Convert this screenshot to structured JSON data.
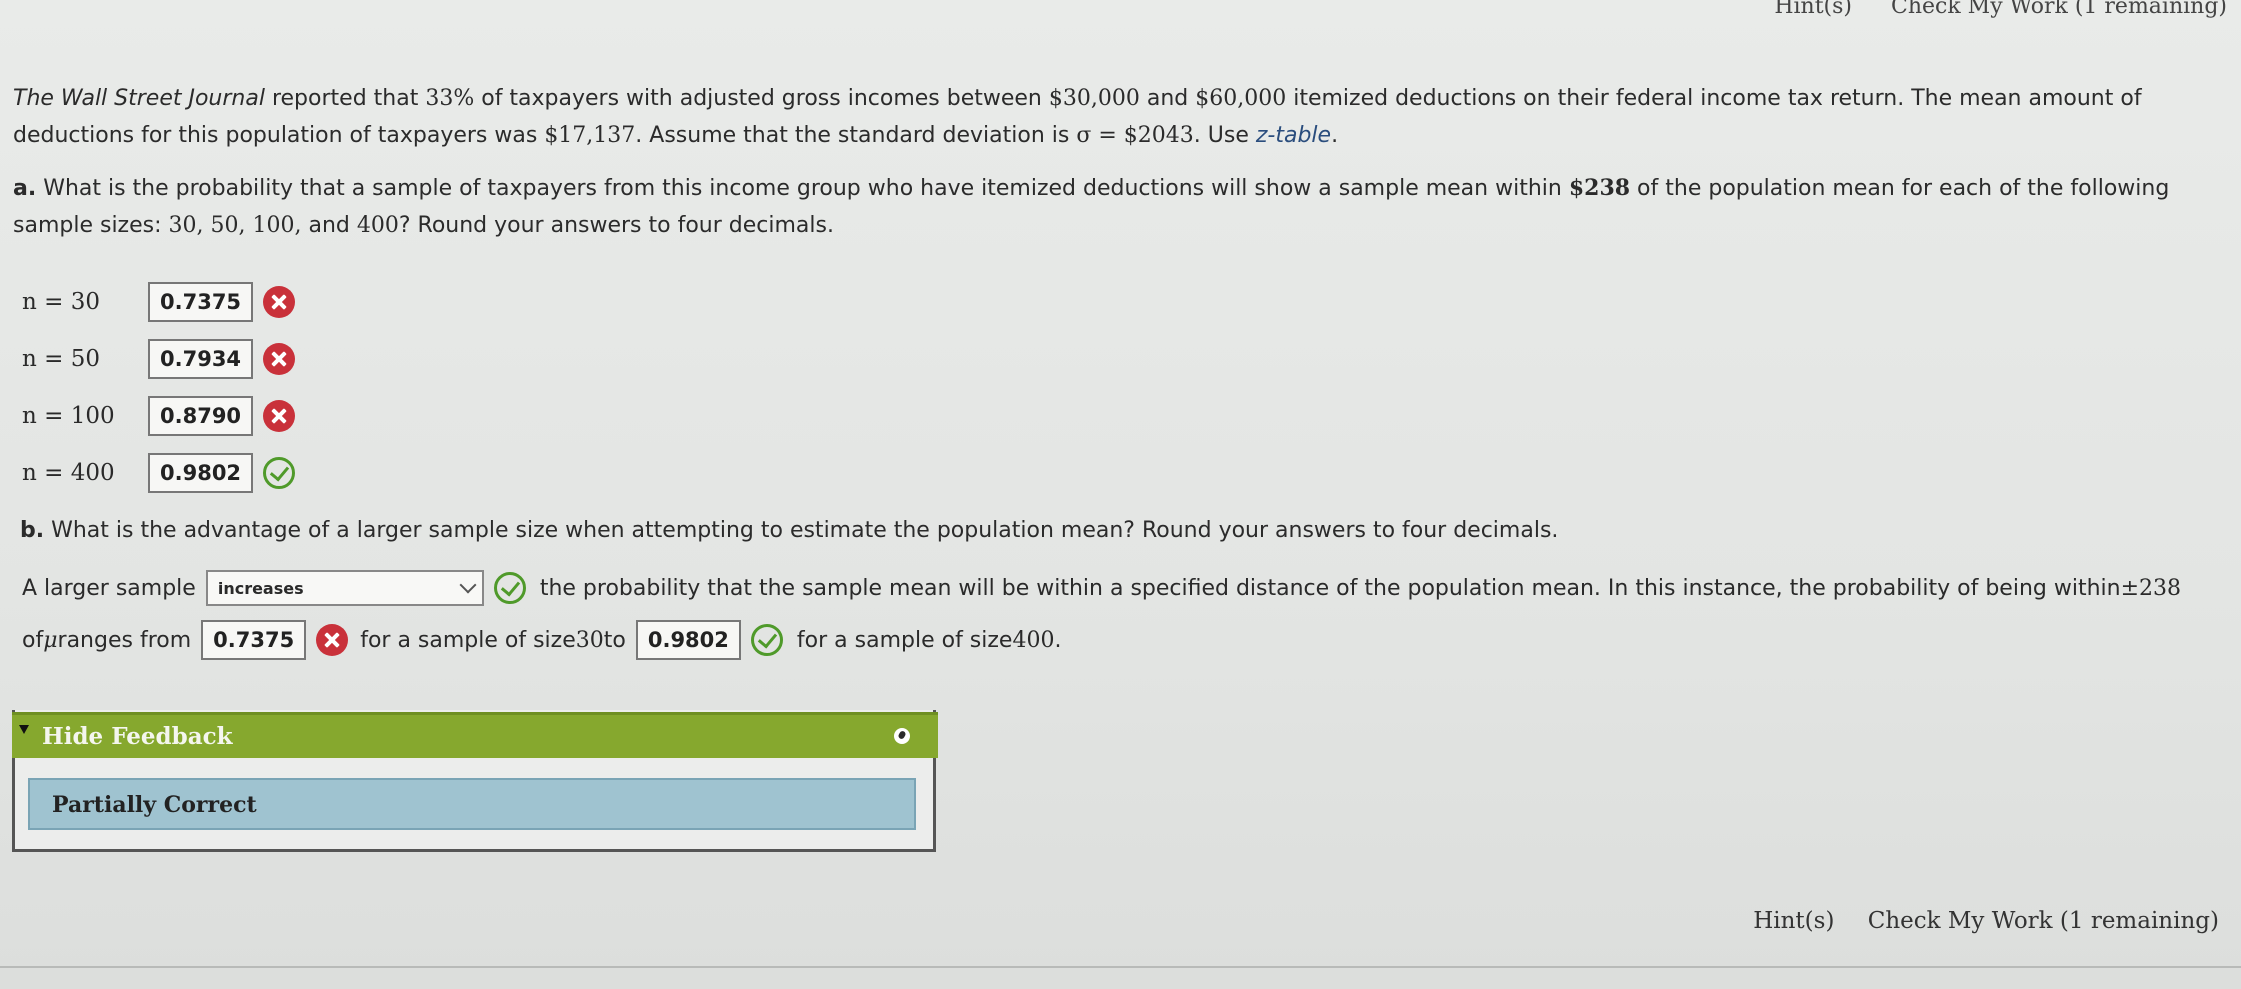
{
  "header": {
    "hints_label": "Hint(s)",
    "check_label": "Check My Work (1 remaining)"
  },
  "intro": {
    "journal": "The Wall Street Journal",
    "text1": " reported that ",
    "pct": "33%",
    "text2": " of taxpayers with adjusted gross incomes between ",
    "lo": "$30,000",
    "text3": " and ",
    "hi": "$60,000",
    "text4": " itemized deductions on their federal income tax return. The mean amount of",
    "text5": "deductions for this population of taxpayers was ",
    "mean": "$17,137",
    "text6": ". Assume that the standard deviation is ",
    "sigma": "σ = $2043",
    "text7": ". Use ",
    "ztable": "z-table",
    "text8": "."
  },
  "part_a": {
    "label": "a.",
    "text1": " What is the probability that a sample of taxpayers from this income group who have itemized deductions will show a sample mean within ",
    "amount": "$238",
    "text2": " of the population mean for each of the following",
    "text3": "sample sizes: ",
    "sizes": "30, 50, 100,",
    "and": " and ",
    "last": "400",
    "text4": "? Round your answers to four decimals.",
    "rows": [
      {
        "n": "n = 30",
        "value": "0.7375",
        "status": "incorrect"
      },
      {
        "n": "n = 50",
        "value": "0.7934",
        "status": "incorrect"
      },
      {
        "n": "n = 100",
        "value": "0.8790",
        "status": "incorrect"
      },
      {
        "n": "n = 400",
        "value": "0.9802",
        "status": "correct"
      }
    ]
  },
  "part_b": {
    "label": "b.",
    "question": " What is the advantage of a larger sample size when attempting to estimate the population mean? Round your answers to four decimals.",
    "s1": "A larger sample",
    "select_value": "increases",
    "s2": "the probability that the sample mean will be within a specified distance of the population mean. In this instance, the probability of being within ",
    "pm": "±238",
    "s3": "of ",
    "mu": "μ",
    "s4": " ranges from",
    "value1": "0.7375",
    "s5": "for a sample of size ",
    "n1": "30",
    "s6": " to",
    "value2": "0.9802",
    "s7": "for a sample of size ",
    "n2": "400",
    "s8": "."
  },
  "feedback": {
    "toggle_label": "Hide Feedback",
    "status": "Partially Correct"
  },
  "colors": {
    "incorrect": "#c9313a",
    "correct": "#4f9a2a",
    "feedback_header": "#86a82e",
    "status_bar": "#9fc3d0"
  }
}
